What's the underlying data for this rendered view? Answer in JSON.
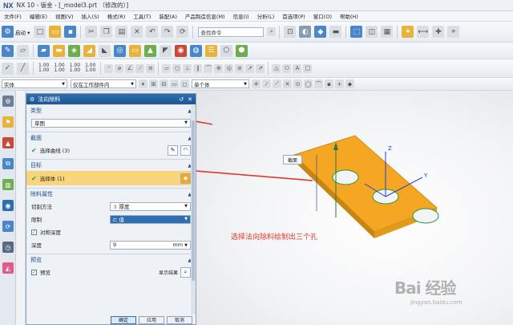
{
  "window": {
    "logo": "NX",
    "title": "NX 10 - 钣金 - [_model3.prt （修改的）]"
  },
  "menu": [
    "文件(F)",
    "编辑(E)",
    "视图(V)",
    "插入(S)",
    "格式(R)",
    "工具(T)",
    "装配(A)",
    "产品制造信息(M)",
    "信息(I)",
    "分析(L)",
    "首选项(P)",
    "窗口(O)",
    "帮助(H)"
  ],
  "toolbar": {
    "start_label": "启动 ▾",
    "search_placeholder": "查找命令",
    "numbers": [
      "1.00\n1.00",
      "1.00\n1.00",
      "1.00\n1.00",
      "1.00\n1.00"
    ]
  },
  "filter_bar": {
    "type_filter": "实体",
    "scope_filter": "仅在工作部件内",
    "selection_filter": "单个体"
  },
  "dialog": {
    "title": "法向除料",
    "sections": {
      "type": {
        "header": "类型",
        "value": "草图"
      },
      "section": {
        "header": "截面",
        "row_label": "选择曲线 (3)"
      },
      "target": {
        "header": "目标",
        "row_label": "选择体 (1)"
      },
      "properties": {
        "header": "除料属性",
        "cut_method_label": "切割方法",
        "cut_method_value": "厚度",
        "limit_label": "限制",
        "limit_value": "值",
        "symmetric_label": "对称深度",
        "depth_label": "深度",
        "depth_value": "9",
        "depth_unit": "mm"
      },
      "preview": {
        "header": "预览",
        "preview_label": "预览",
        "show_result": "显示结果"
      }
    },
    "buttons": {
      "ok": "确定",
      "apply": "应用",
      "cancel": "取消"
    }
  },
  "viewport": {
    "tooltip": "截面",
    "annotation": "选择法向除料绘制出三个孔",
    "axis_y": "Y",
    "axis_z": "Z"
  },
  "watermark": {
    "brand": "Bai 经验",
    "sub": "jingyan.baidu.com"
  },
  "colors": {
    "accent": "#1f5592",
    "plate": "#f5a623",
    "annotation": "#e0392b",
    "highlight": "#f8d57a"
  }
}
